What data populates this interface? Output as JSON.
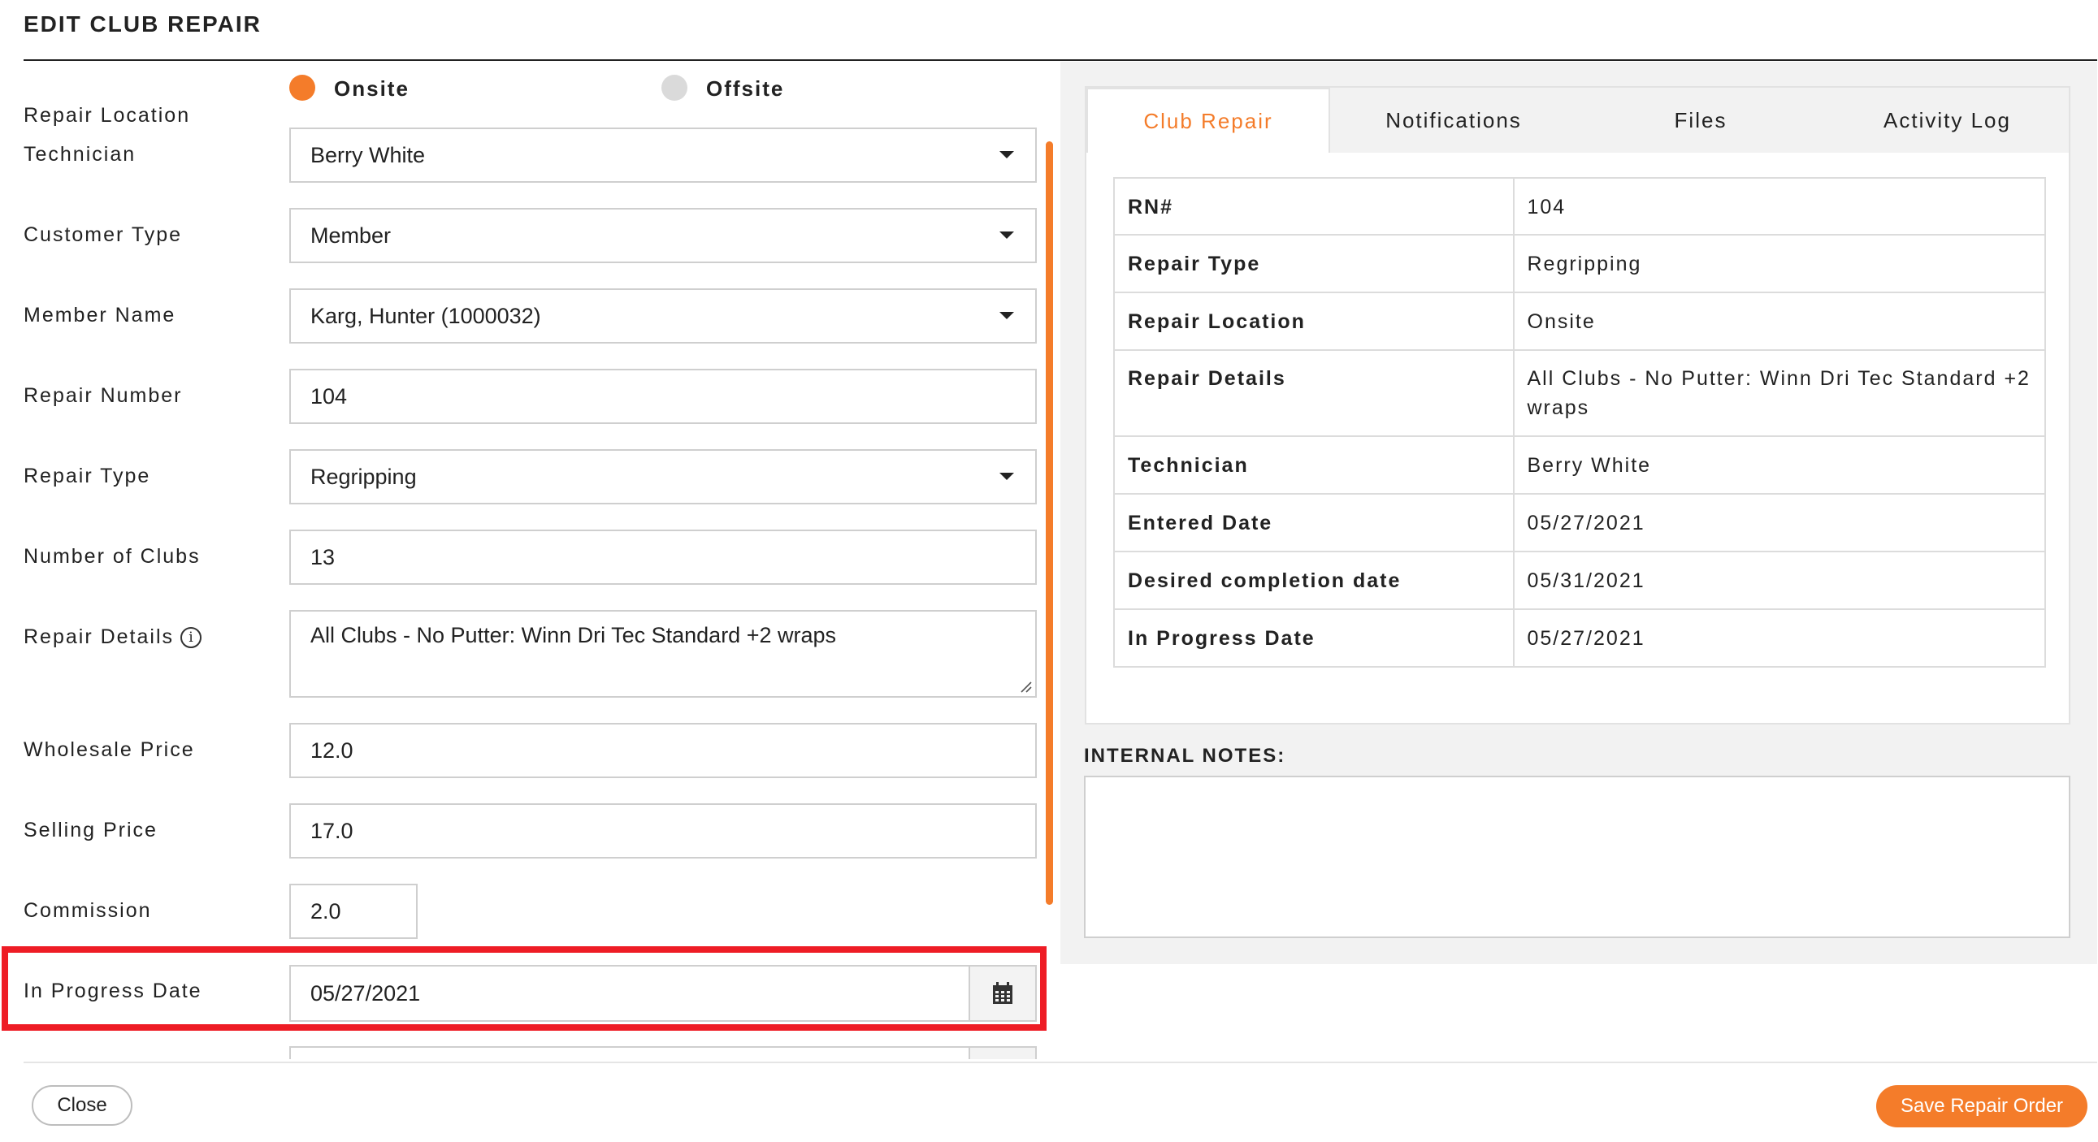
{
  "title": "EDIT CLUB REPAIR",
  "accent_color": "#f47c2a",
  "form": {
    "repair_location": {
      "label": "Repair Location",
      "options": [
        {
          "label": "Onsite",
          "selected": true
        },
        {
          "label": "Offsite",
          "selected": false
        }
      ]
    },
    "technician": {
      "label": "Technician",
      "value": "Berry White"
    },
    "customer_type": {
      "label": "Customer Type",
      "value": "Member"
    },
    "member_name": {
      "label": "Member Name",
      "value": "Karg, Hunter (1000032)"
    },
    "repair_number": {
      "label": "Repair Number",
      "value": "104"
    },
    "repair_type": {
      "label": "Repair Type",
      "value": "Regripping"
    },
    "number_of_clubs": {
      "label": "Number of Clubs",
      "value": "13"
    },
    "repair_details": {
      "label": "Repair Details",
      "value": "All Clubs - No Putter: Winn Dri Tec Standard +2 wraps",
      "info_icon": "info-icon"
    },
    "wholesale_price": {
      "label": "Wholesale Price",
      "value": "12.0"
    },
    "selling_price": {
      "label": "Selling Price",
      "value": "17.0"
    },
    "commission": {
      "label": "Commission",
      "value": "2.0"
    },
    "in_progress_date": {
      "label": "In Progress Date",
      "value": "05/27/2021",
      "icon": "calendar-icon"
    }
  },
  "tabs": [
    {
      "label": "Club Repair",
      "active": true
    },
    {
      "label": "Notifications",
      "active": false
    },
    {
      "label": "Files",
      "active": false
    },
    {
      "label": "Activity Log",
      "active": false
    }
  ],
  "details": [
    {
      "key": "RN#",
      "value": "104"
    },
    {
      "key": "Repair Type",
      "value": "Regripping"
    },
    {
      "key": "Repair Location",
      "value": "Onsite"
    },
    {
      "key": "Repair Details",
      "value": "All Clubs - No Putter: Winn Dri Tec Standard +2 wraps"
    },
    {
      "key": "Technician",
      "value": "Berry White"
    },
    {
      "key": "Entered Date",
      "value": "05/27/2021"
    },
    {
      "key": "Desired completion date",
      "value": "05/31/2021"
    },
    {
      "key": "In Progress Date",
      "value": "05/27/2021"
    }
  ],
  "internal_notes": {
    "label": "INTERNAL NOTES:",
    "value": ""
  },
  "buttons": {
    "close": "Close",
    "save": "Save Repair Order"
  }
}
